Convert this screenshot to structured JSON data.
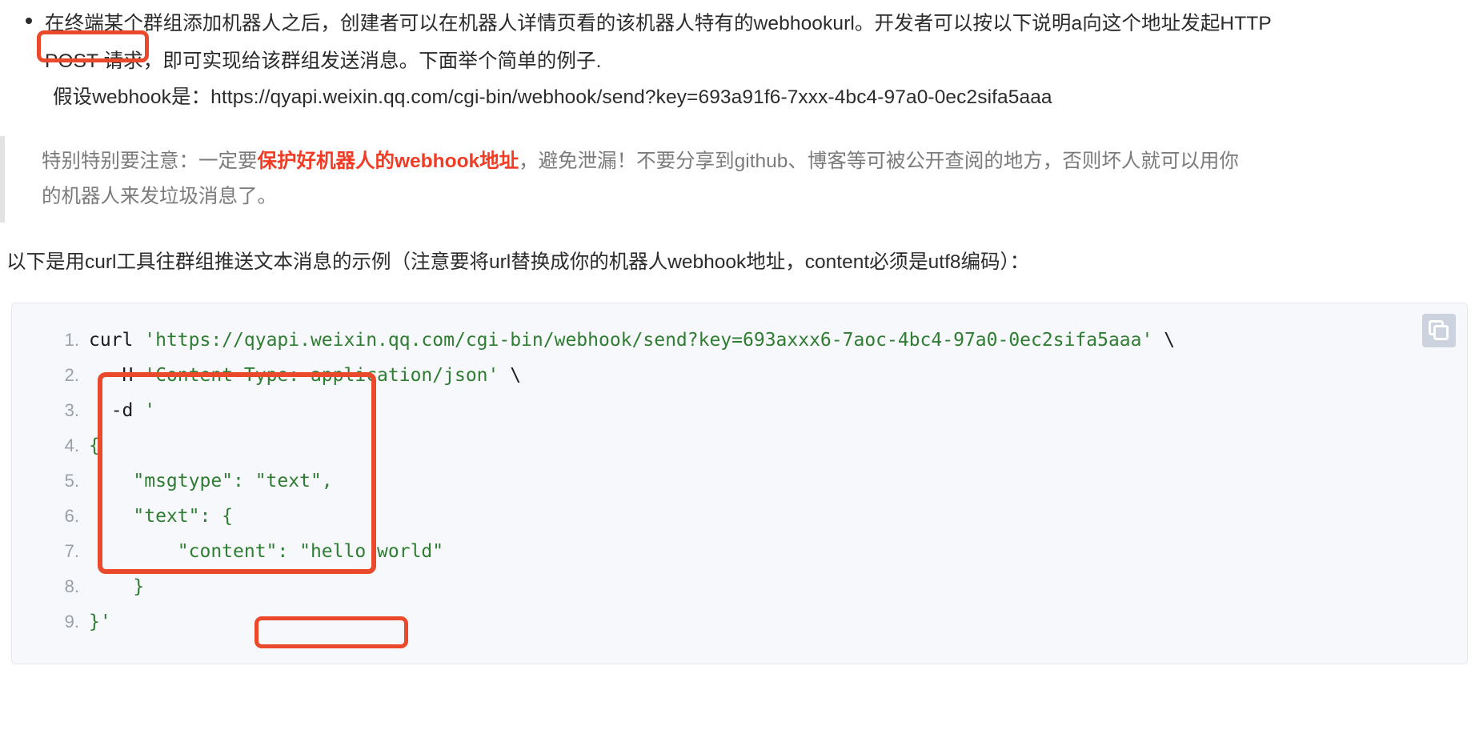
{
  "document": {
    "bullet": {
      "line1": "在终端某个群组添加机器人之后，创建者可以在机器人详情页看的该机器人特有的webhookurl。开发者可以按以下说明a向这个地址发起HTTP",
      "line2_highlight": "POST 请求",
      "line2_rest": "，即可实现给该群组发送消息。下面举个简单的例子.",
      "line3": "假设webhook是：https://qyapi.weixin.qq.com/cgi-bin/webhook/send?key=693a91f6-7xxx-4bc4-97a0-0ec2sifa5aaa"
    },
    "blockquote": {
      "prefix": "特别特别要注意：一定要",
      "emphasis": "保护好机器人的webhook地址",
      "suffix": "，避免泄漏！不要分享到github、博客等可被公开查阅的地方，否则坏人就可以用你",
      "line2": "的机器人来发垃圾消息了。"
    },
    "paragraph": "以下是用curl工具往群组推送文本消息的示例（注意要将url替换成你的机器人webhook地址，content必须是utf8编码）：",
    "code_block": {
      "copy_icon": "copy-icon",
      "language": "shell",
      "lines": [
        {
          "num": "1",
          "plain_pre": "curl ",
          "string": "'https://qyapi.weixin.qq.com/cgi-bin/webhook/send?key=693axxx6-7aoc-4bc4-97a0-0ec2sifa5aaa'",
          "plain_post": " \\"
        },
        {
          "num": "2",
          "plain_pre": "  -H ",
          "string": "'Content-Type: application/json'",
          "plain_post": " \\"
        },
        {
          "num": "3",
          "plain_pre": "  -d ",
          "string": "'",
          "plain_post": ""
        },
        {
          "num": "4",
          "plain_pre": "",
          "string": "{",
          "plain_post": ""
        },
        {
          "num": "5",
          "plain_pre": "",
          "string": "    \"msgtype\": \"text\",",
          "plain_post": ""
        },
        {
          "num": "6",
          "plain_pre": "",
          "string": "    \"text\": {",
          "plain_post": ""
        },
        {
          "num": "7",
          "plain_pre": "",
          "string": "        \"content\": \"hello world\"",
          "plain_post": ""
        },
        {
          "num": "8",
          "plain_pre": "",
          "string": "    }",
          "plain_post": ""
        },
        {
          "num": "9",
          "plain_pre": "",
          "string": "}'",
          "plain_post": ""
        }
      ]
    },
    "annotations": {
      "post_box": "POST 请求",
      "json_box": "application/json",
      "payload_box": "json-payload"
    },
    "colors": {
      "annotation_red": "#ea4a2b",
      "emphasis_red": "#f03c24",
      "code_string_green": "#2f7d32",
      "code_bg": "#f7f8fb",
      "quote_bar": "#e3e3e3",
      "line_number": "#9aa0a6"
    }
  }
}
